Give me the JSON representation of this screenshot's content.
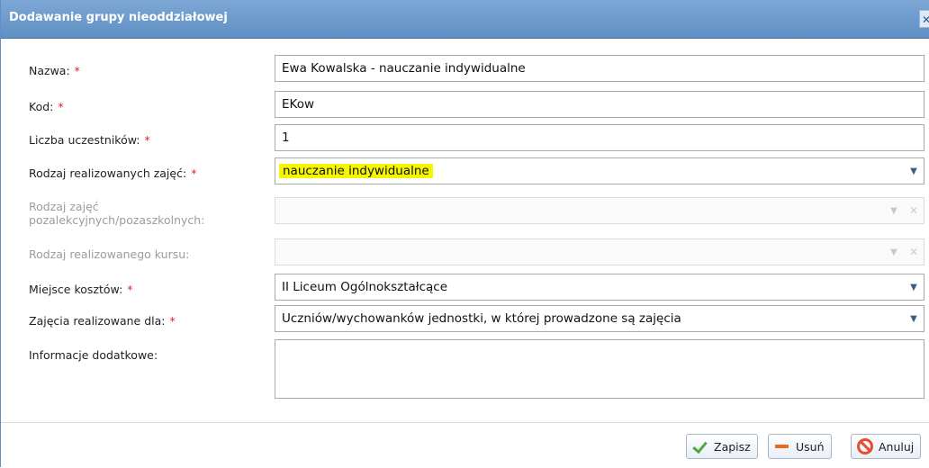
{
  "dialog": {
    "title": "Dodawanie grupy nieoddziałowej",
    "close_glyph": "✕"
  },
  "form": {
    "required_mark": "*",
    "nazwa": {
      "label": "Nazwa:",
      "value": "Ewa Kowalska - nauczanie indywidualne"
    },
    "kod": {
      "label": "Kod:",
      "value": "EKow"
    },
    "liczba": {
      "label": "Liczba uczestników:",
      "value": "1"
    },
    "rodzaj_zajec": {
      "label": "Rodzaj realizowanych zajęć:",
      "value": "nauczanie indywidualne",
      "highlight_color": "#f6f600"
    },
    "rodzaj_pozalekcyjnych": {
      "label_line1": "Rodzaj zajęć",
      "label_line2": "pozalekcyjnych/pozaszkolnych:",
      "value": ""
    },
    "rodzaj_kursu": {
      "label": "Rodzaj realizowanego kursu:",
      "value": ""
    },
    "miejsce_kosztow": {
      "label": "Miejsce kosztów:",
      "value": "II Liceum Ogólnokształcące"
    },
    "zajecia_dla": {
      "label": "Zajęcia realizowane dla:",
      "value": "Uczniów/wychowanków jednostki, w której prowadzone są  zajęcia"
    },
    "informacje": {
      "label": "Informacje dodatkowe:",
      "value": ""
    }
  },
  "footer": {
    "save_label": "Zapisz",
    "delete_label": "Usuń",
    "cancel_label": "Anuluj"
  },
  "colors": {
    "titlebar": "#6a98cb",
    "required": "#e0202a",
    "save_icon": "#4bab3e",
    "delete_icon": "#e86a1c",
    "cancel_icon": "#e4502f"
  },
  "icons": [
    "close-icon",
    "chevron-down-icon",
    "clear-icon",
    "check-icon",
    "minus-icon",
    "cancel-icon"
  ]
}
